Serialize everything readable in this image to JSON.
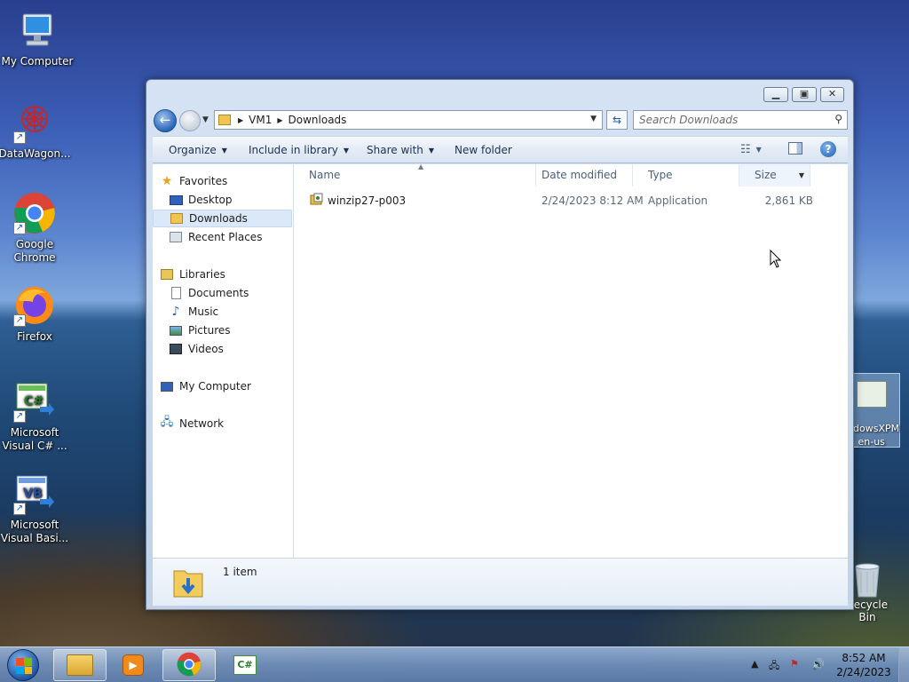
{
  "desktop": {
    "icons": [
      {
        "label": "My Computer",
        "icon": "computer-icon"
      },
      {
        "label": "DataWagon...",
        "icon": "datawagon-icon"
      },
      {
        "label": "Google Chrome",
        "icon": "chrome-icon"
      },
      {
        "label": "Firefox",
        "icon": "firefox-icon"
      },
      {
        "label": "Microsoft Visual C# ...",
        "icon": "visual-csharp-icon"
      },
      {
        "label": "Microsoft Visual Basi...",
        "icon": "visual-basic-icon"
      }
    ],
    "partial_icon_label": "dowsXPM\n_en-us",
    "recycle_bin_label": "Recycle Bin"
  },
  "window": {
    "path": [
      "VM1",
      "Downloads"
    ],
    "search_placeholder": "Search Downloads",
    "toolbar": {
      "organize": "Organize",
      "include_in_library": "Include in library",
      "share_with": "Share with",
      "new_folder": "New folder"
    },
    "nav": {
      "favorites": "Favorites",
      "favorites_items": [
        "Desktop",
        "Downloads",
        "Recent Places"
      ],
      "libraries": "Libraries",
      "libraries_items": [
        "Documents",
        "Music",
        "Pictures",
        "Videos"
      ],
      "my_computer": "My Computer",
      "network": "Network"
    },
    "columns": {
      "name": "Name",
      "date_modified": "Date modified",
      "type": "Type",
      "size": "Size"
    },
    "files": [
      {
        "name": "winzip27-p003",
        "date_modified": "2/24/2023 8:12 AM",
        "type": "Application",
        "size": "2,861 KB"
      }
    ],
    "details": {
      "count": "1 item"
    }
  },
  "taskbar": {
    "clock_time": "8:52 AM",
    "clock_date": "2/24/2023"
  }
}
